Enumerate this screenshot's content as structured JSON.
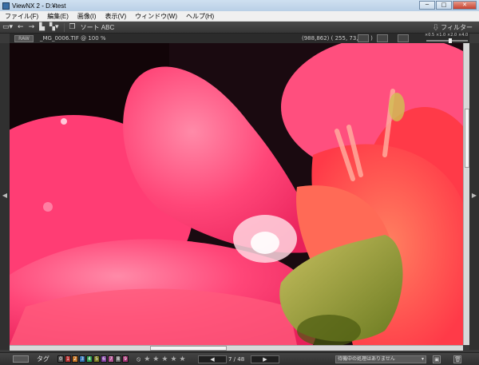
{
  "window": {
    "title": "ViewNX 2 - D:¥test",
    "min_label": "─",
    "max_label": "□",
    "close_label": "✕"
  },
  "menu": [
    "ファイル(F)",
    "編集(E)",
    "画像(I)",
    "表示(V)",
    "ウィンドウ(W)",
    "ヘルプ(H)"
  ],
  "toolbar": {
    "sort_label": "ソート ABC",
    "filter_label": "フィルター"
  },
  "infobar": {
    "format_badge": "RAW",
    "filename": "_MG_0006.TIF @ 100 %",
    "coords": "(988,862) ( 255, 73,125 )",
    "zoom_levels": [
      "×0.5",
      "×1.0",
      "×2.0",
      "×4.0"
    ],
    "zoom_value": "×2.0"
  },
  "bottom": {
    "tag_label": "タグ",
    "label_numbers": [
      "0",
      "1",
      "2",
      "3",
      "4",
      "5",
      "6",
      "7",
      "8",
      "9"
    ],
    "label_colors": [
      "#555555",
      "#b03030",
      "#c07020",
      "#3070b0",
      "#30a050",
      "#7a7a20",
      "#8040a0",
      "#b05090",
      "#6a6a6a",
      "#a03070"
    ],
    "rating_symbol": "⦸",
    "stars": [
      "★",
      "★",
      "★",
      "★",
      "★"
    ],
    "prev_label": "◀",
    "next_label": "▶",
    "page_count": "7 / 48",
    "status_text": "待機中の処理はありません"
  },
  "side": {
    "left_arrow": "◀",
    "right_arrow": "▶"
  },
  "colors": {
    "petal_main": "#ff3d74",
    "petal_light": "#ff7fa5",
    "petal_orange": "#ff5540",
    "center_green": "#9aa83a",
    "background": "#1a0a10"
  }
}
